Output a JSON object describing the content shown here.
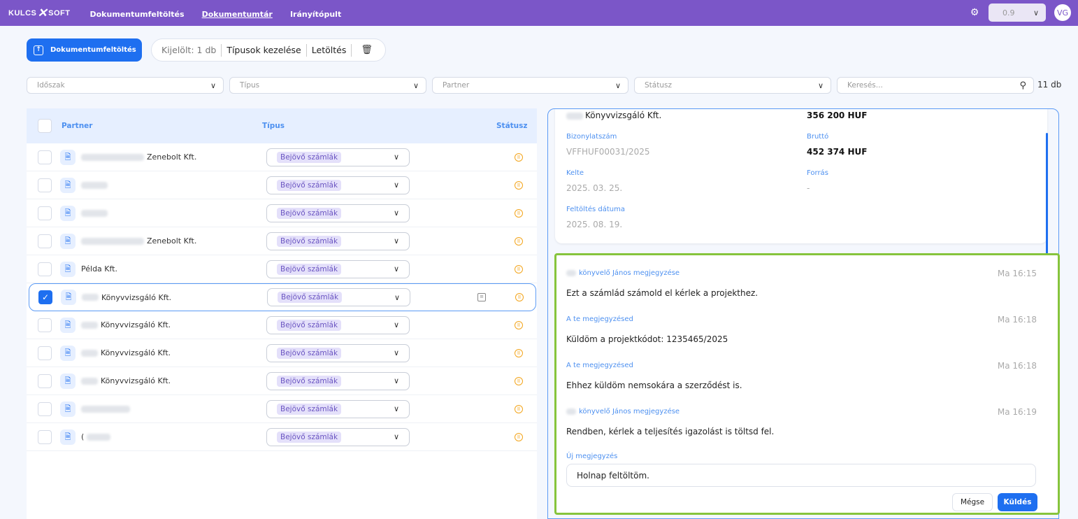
{
  "header": {
    "logo_left": "KULCS",
    "logo_right": "SOFT",
    "nav": [
      "Dokumentumfeltöltés",
      "Dokumentumtár",
      "Irányítópult"
    ],
    "version": "0.9",
    "avatar": "VG"
  },
  "toolbar": {
    "upload_label": "Dokumentumfeltöltés",
    "selected": "Kijelölt: 1 db",
    "manage_types": "Típusok kezelése",
    "download": "Letöltés"
  },
  "filters": {
    "period": "Időszak",
    "type": "Típus",
    "partner": "Partner",
    "status": "Státusz",
    "search_placeholder": "Keresés...",
    "count": "11 db"
  },
  "list": {
    "headers": {
      "partner": "Partner",
      "type": "Típus",
      "status": "Státusz"
    },
    "rows": [
      {
        "partner_suffix": "Zenebolt Kft.",
        "type": "Bejövő számlák",
        "checked": false
      },
      {
        "partner_suffix": "",
        "type": "Bejövő számlák",
        "checked": false
      },
      {
        "partner_suffix": "",
        "type": "Bejövő számlák",
        "checked": false
      },
      {
        "partner_suffix": "Zenebolt Kft.",
        "type": "Bejövő számlák",
        "checked": false
      },
      {
        "partner_suffix": "Példa Kft.",
        "type": "Bejövő számlák",
        "checked": false
      },
      {
        "partner_suffix": "Könyvvizsgáló Kft.",
        "type": "Bejövő számlák",
        "checked": true
      },
      {
        "partner_suffix": "Könyvvizsgáló Kft.",
        "type": "Bejövő számlák",
        "checked": false
      },
      {
        "partner_suffix": "Könyvvizsgáló Kft.",
        "type": "Bejövő számlák",
        "checked": false
      },
      {
        "partner_suffix": "Könyvvizsgáló Kft.",
        "type": "Bejövő számlák",
        "checked": false
      },
      {
        "partner_suffix": "",
        "type": "Bejövő számlák",
        "checked": false
      },
      {
        "partner_suffix": "",
        "type": "Bejövő számlák",
        "checked": false
      }
    ]
  },
  "detail": {
    "partner": "Könyvvizsgáló Kft.",
    "net": "356 200 HUF",
    "doc_no_label": "Bizonylatszám",
    "doc_no": "VFFHUF00031/2025",
    "gross_label": "Bruttó",
    "gross": "452 374 HUF",
    "date_label": "Kelte",
    "date": "2025. 03. 25.",
    "source_label": "Forrás",
    "source": "-",
    "upload_date_label": "Feltöltés dátuma",
    "upload_date": "2025. 08. 19."
  },
  "notes": {
    "items": [
      {
        "author": "könyvelő János megjegyzése",
        "time": "Ma 16:15",
        "text": "Ezt a számlád számold el kérlek a projekthez."
      },
      {
        "author": "A te megjegyzésed",
        "time": "Ma 16:18",
        "text": "Küldöm a projektkódot: 1235465/2025"
      },
      {
        "author": "A te megjegyzésed",
        "time": "Ma 16:18",
        "text": "Ehhez küldöm nemsokára a szerződést is."
      },
      {
        "author": "könyvelő János megjegyzése",
        "time": "Ma 16:19",
        "text": "Rendben, kérlek a teljesítés igazolást is töltsd fel."
      }
    ],
    "new_label": "Új megjegyzés",
    "new_value": "Holnap feltöltöm.",
    "cancel": "Mégse",
    "send": "Küldés"
  }
}
